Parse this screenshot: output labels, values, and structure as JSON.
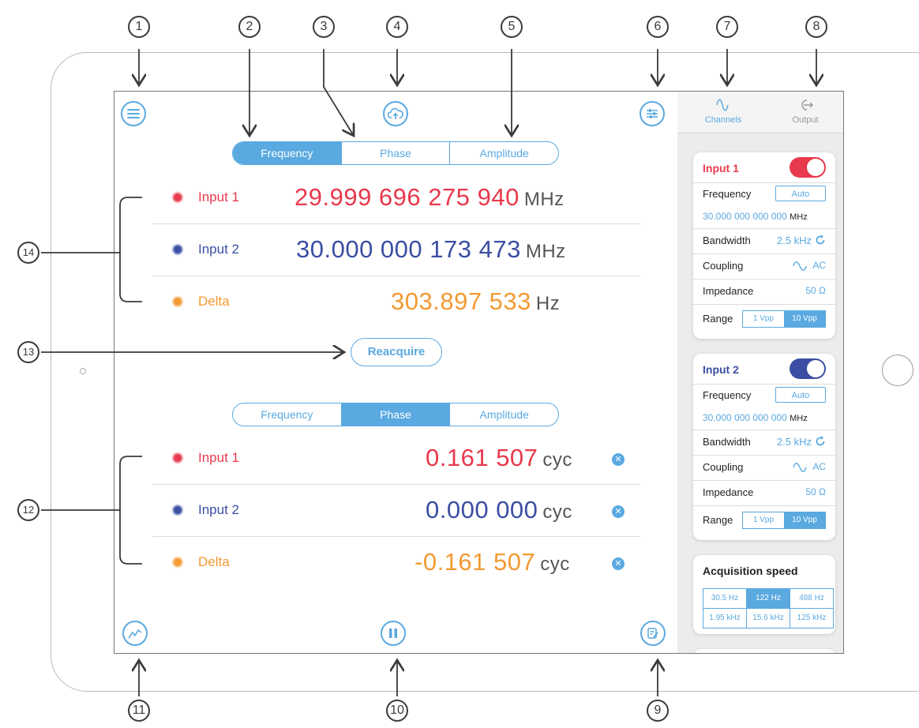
{
  "colors": {
    "accent": "#5aa9e0",
    "input1": "#e8394d",
    "input2": "#3b4ea3",
    "delta": "#f39a32",
    "toggle1": "#e8394d",
    "toggle2": "#3b4ea3"
  },
  "callouts": [
    "1",
    "2",
    "3",
    "4",
    "5",
    "6",
    "7",
    "8",
    "9",
    "10",
    "11",
    "12",
    "13",
    "14"
  ],
  "top_tabs": {
    "items": [
      "Frequency",
      "Phase",
      "Amplitude"
    ],
    "selected": "Frequency"
  },
  "bottom_tabs": {
    "items": [
      "Frequency",
      "Phase",
      "Amplitude"
    ],
    "selected": "Phase"
  },
  "frequency_rows": [
    {
      "label": "Input 1",
      "value": "29.999 696 275 940",
      "unit": "MHz"
    },
    {
      "label": "Input 2",
      "value": "30.000 000 173 473",
      "unit": "MHz"
    },
    {
      "label": "Delta",
      "value": "303.897 533",
      "unit": "Hz"
    }
  ],
  "phase_rows": [
    {
      "label": "Input 1",
      "value": "0.161 507",
      "unit": "cyc"
    },
    {
      "label": "Input 2",
      "value": "0.000 000",
      "unit": "cyc"
    },
    {
      "label": "Delta",
      "value": "-0.161 507",
      "unit": "cyc"
    }
  ],
  "reacquire_label": "Reacquire",
  "icons": {
    "menu": "menu-icon",
    "upload": "cloud-upload-icon",
    "settings": "sliders-icon",
    "chart": "chart-icon",
    "pause": "pause-icon",
    "notes": "notes-icon",
    "channels": "sine-wave-icon",
    "output": "output-arrow-icon",
    "refresh": "refresh-icon",
    "close": "close-icon"
  },
  "sidebar": {
    "tabs": [
      {
        "label": "Channels",
        "active": true
      },
      {
        "label": "Output",
        "active": false
      }
    ],
    "channels": [
      {
        "title": "Input 1",
        "frequency_label": "Frequency",
        "auto_label": "Auto",
        "frequency_value": "30.000 000 000 000",
        "frequency_unit": "MHz",
        "bandwidth_label": "Bandwidth",
        "bandwidth_value": "2.5 kHz",
        "coupling_label": "Coupling",
        "coupling_value": "AC",
        "impedance_label": "Impedance",
        "impedance_value": "50 Ω",
        "range_label": "Range",
        "range_options": [
          "1 Vpp",
          "10 Vpp"
        ],
        "range_selected": "10 Vpp",
        "enabled": true
      },
      {
        "title": "Input 2",
        "frequency_label": "Frequency",
        "auto_label": "Auto",
        "frequency_value": "30.000 000 000 000",
        "frequency_unit": "MHz",
        "bandwidth_label": "Bandwidth",
        "bandwidth_value": "2.5 kHz",
        "coupling_label": "Coupling",
        "coupling_value": "AC",
        "impedance_label": "Impedance",
        "impedance_value": "50 Ω",
        "range_label": "Range",
        "range_options": [
          "1 Vpp",
          "10 Vpp"
        ],
        "range_selected": "10 Vpp",
        "enabled": true
      }
    ],
    "acquisition": {
      "title": "Acquisition speed",
      "options": [
        "30.5 Hz",
        "122 Hz",
        "488 Hz",
        "1.95 kHz",
        "15.6 kHz",
        "125 kHz"
      ],
      "selected": "122 Hz"
    }
  }
}
